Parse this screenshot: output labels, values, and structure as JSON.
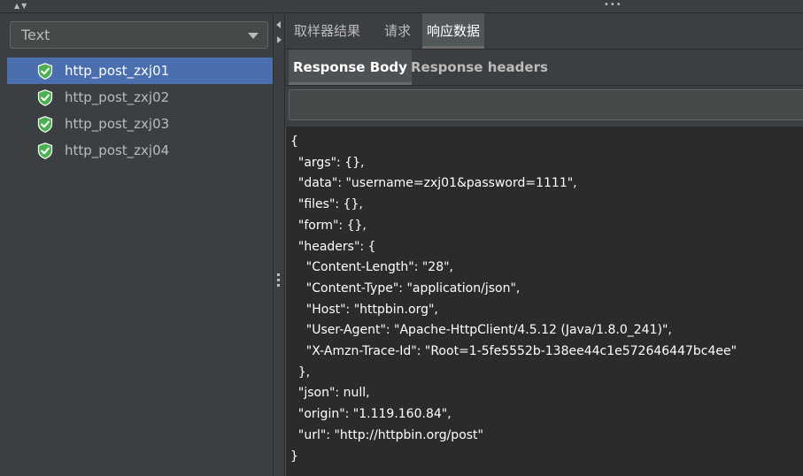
{
  "left_panel": {
    "renderer": {
      "selected": "Text"
    },
    "results": [
      {
        "label": "http_post_zxj01",
        "status": "success",
        "selected": true
      },
      {
        "label": "http_post_zxj02",
        "status": "success",
        "selected": false
      },
      {
        "label": "http_post_zxj03",
        "status": "success",
        "selected": false
      },
      {
        "label": "http_post_zxj04",
        "status": "success",
        "selected": false
      }
    ]
  },
  "tabs": {
    "sampler_result": "取样器结果",
    "request": "请求",
    "response_data": "响应数据",
    "active": "response_data"
  },
  "subtabs": {
    "response_body": "Response Body",
    "response_headers": "Response headers",
    "active": "response_body"
  },
  "search": {
    "value": ""
  },
  "response_body": {
    "lines": [
      "{",
      "  \"args\": {},",
      "  \"data\": \"username=zxj01&password=1111\",",
      "  \"files\": {},",
      "  \"form\": {},",
      "  \"headers\": {",
      "    \"Content-Length\": \"28\",",
      "    \"Content-Type\": \"application/json\",",
      "    \"Host\": \"httpbin.org\",",
      "    \"User-Agent\": \"Apache-HttpClient/4.5.12 (Java/1.8.0_241)\",",
      "    \"X-Amzn-Trace-Id\": \"Root=1-5fe5552b-138ee44c1e572646447bc4ee\"",
      "  },",
      "  \"json\": null,",
      "  \"origin\": \"1.119.160.84\",",
      "  \"url\": \"http://httpbin.org/post\"",
      "}"
    ]
  },
  "colors": {
    "background": "#3c3f41",
    "selection": "#4b6eaf",
    "editor_background": "#2b2b2b",
    "success_icon": "#4caf50"
  },
  "icons": {
    "result_status": "shield-check-icon",
    "combo_caret": "chevron-down-icon"
  }
}
